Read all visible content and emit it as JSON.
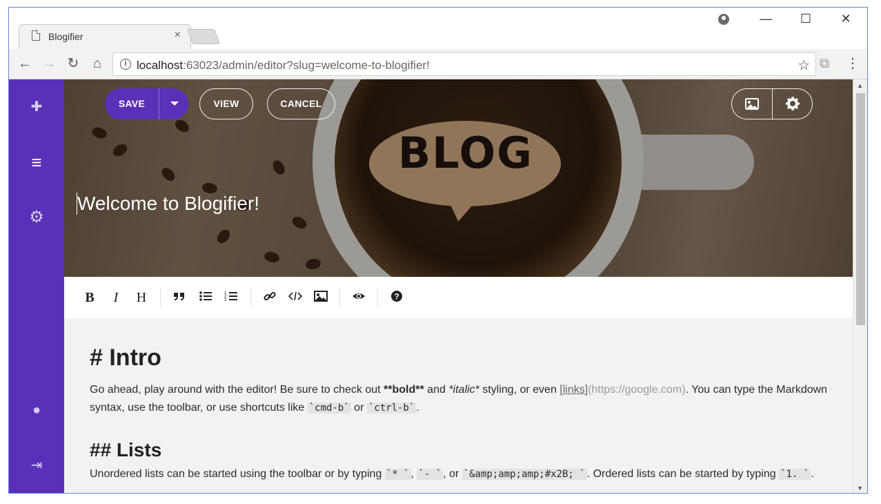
{
  "browser": {
    "tab_title": "Blogifier",
    "tab_close": "×",
    "url_host": "localhost",
    "url_rest": ":63023/admin/editor?slug=welcome-to-blogifier!",
    "window_controls": {
      "minimize": "—",
      "maximize": "☐",
      "close": "✕"
    }
  },
  "sidebar": {
    "items": [
      {
        "icon": "plus-icon",
        "glyph": "✚"
      },
      {
        "icon": "align-left-icon",
        "glyph": "≡"
      },
      {
        "icon": "gear-icon",
        "glyph": "⚙"
      },
      {
        "icon": "globe-icon",
        "glyph": "●"
      },
      {
        "icon": "sign-out-icon",
        "glyph": "⇥"
      }
    ]
  },
  "editor_header": {
    "save_label": "SAVE",
    "view_label": "VIEW",
    "cancel_label": "CANCEL",
    "post_title": "Welcome to Blogifier!",
    "hero_text": "BLOG"
  },
  "md_toolbar": {
    "bold": "B",
    "italic": "I",
    "heading": "H"
  },
  "content": {
    "h1": "# Intro",
    "p1_a": "Go ahead, play around with the editor! Be sure to check out ",
    "p1_bold": "**bold**",
    "p1_b": " and ",
    "p1_ital": "*italic*",
    "p1_c": " styling, or even ",
    "p1_link": "[links]",
    "p1_url": "(https://google.com)",
    "p1_d": ". You can type the Markdown syntax, use the toolbar, or use shortcuts like ",
    "p1_code1": "`cmd-b`",
    "p1_e": " or ",
    "p1_code2": "`ctrl-b`",
    "p1_f": ".",
    "h2": "## Lists",
    "p2_a": "Unordered lists can be started using the toolbar or by typing ",
    "p2_code1": "`* `",
    "p2_b": ", ",
    "p2_code2": "`- `",
    "p2_c": ", or ",
    "p2_code3": "`&amp;amp;amp;#x2B; `",
    "p2_d": ". Ordered lists can be started by typing ",
    "p2_code4": "`1. `",
    "p2_e": "."
  },
  "colors": {
    "accent": "#5a30b8"
  }
}
